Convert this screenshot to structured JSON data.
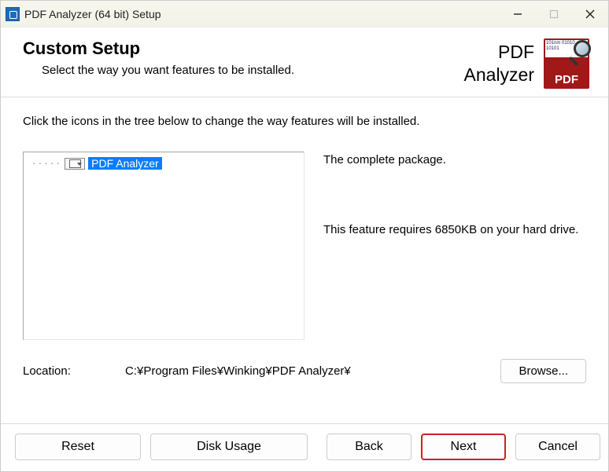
{
  "window": {
    "title": "PDF Analyzer (64 bit) Setup"
  },
  "brand": {
    "line1": "PDF",
    "line2": "Analyzer"
  },
  "header": {
    "title": "Custom Setup",
    "subtitle": "Select the way you want features to be installed."
  },
  "body": {
    "instruction": "Click the icons in the tree below to change the way features will be installed.",
    "tree": {
      "root_label": "PDF Analyzer"
    },
    "description": {
      "summary": "The complete package.",
      "requirement": "This feature requires 6850KB on your hard drive."
    },
    "location": {
      "label": "Location:",
      "path": "C:¥Program Files¥Winking¥PDF Analyzer¥",
      "browse_label": "Browse..."
    }
  },
  "logo": {
    "binary_text": "101nm 01010 10101",
    "pdf_text": "PDF"
  },
  "buttons": {
    "reset": "Reset",
    "disk_usage": "Disk Usage",
    "back": "Back",
    "next": "Next",
    "cancel": "Cancel"
  }
}
